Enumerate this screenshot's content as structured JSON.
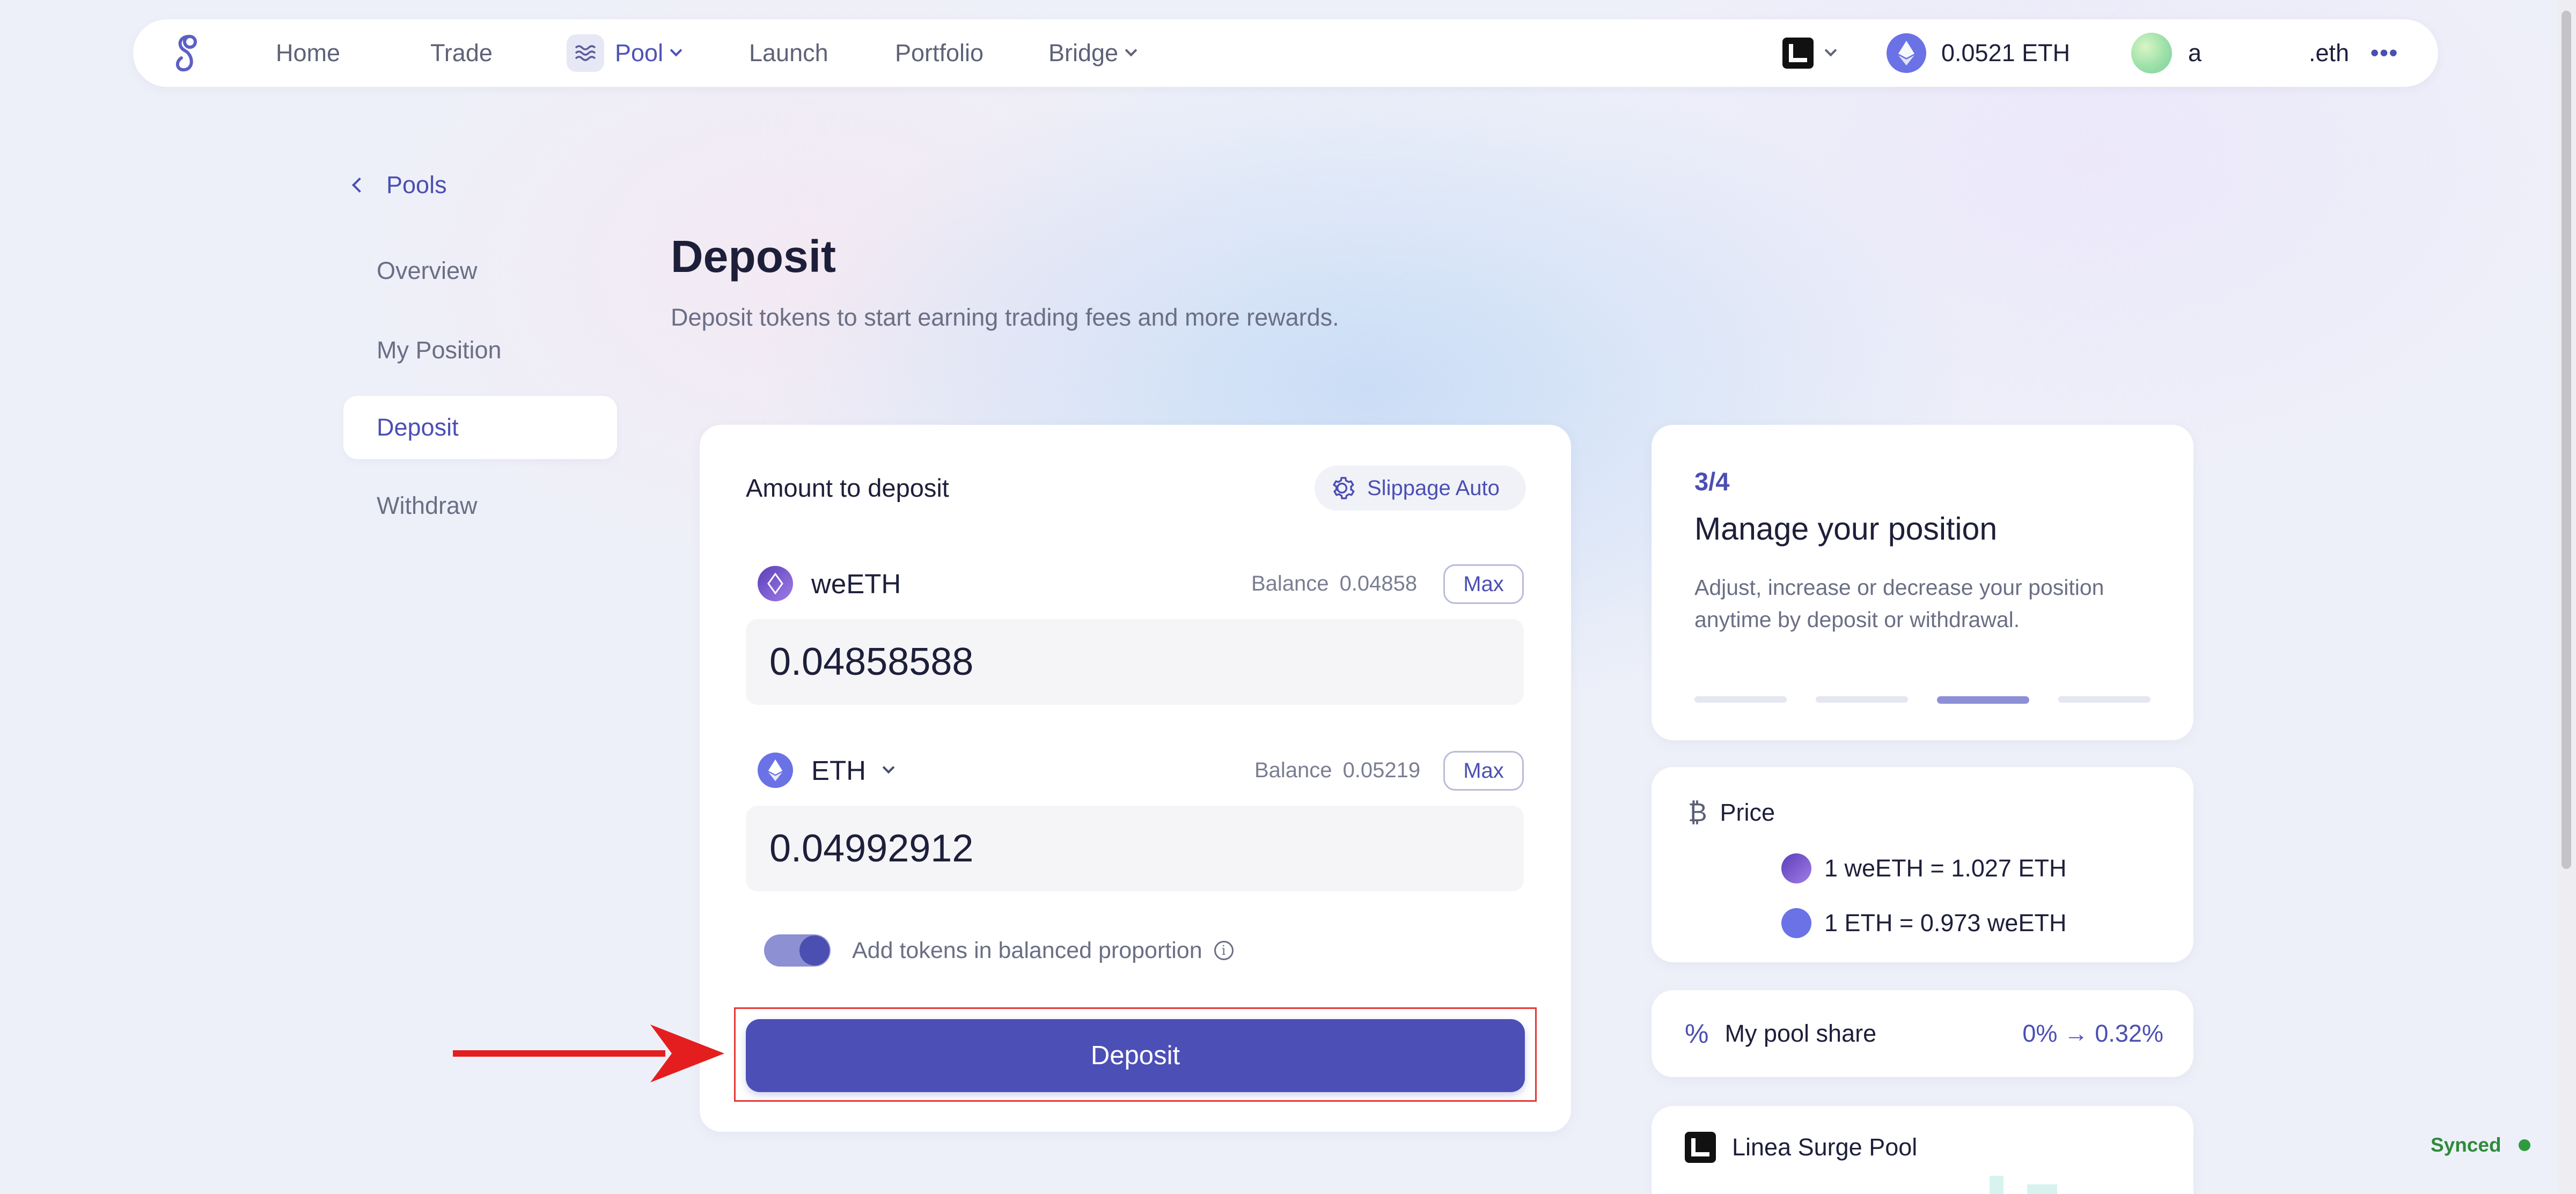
{
  "nav": {
    "home": "Home",
    "trade": "Trade",
    "pool": "Pool",
    "launch": "Launch",
    "portfolio": "Portfolio",
    "bridge": "Bridge",
    "balance": "0.0521 ETH",
    "account_initial": "a",
    "account_suffix": ".eth",
    "more": "•••"
  },
  "breadcrumb": {
    "back_label": "Pools"
  },
  "sidebar": {
    "items": [
      {
        "label": "Overview",
        "active": false
      },
      {
        "label": "My Position",
        "active": false
      },
      {
        "label": "Deposit",
        "active": true
      },
      {
        "label": "Withdraw",
        "active": false
      }
    ]
  },
  "page": {
    "title": "Deposit",
    "subtitle": "Deposit tokens to start earning trading fees and more rewards."
  },
  "deposit_card": {
    "heading": "Amount to deposit",
    "slippage_label": "Slippage Auto",
    "token1": {
      "symbol": "weETH",
      "balance_label": "Balance",
      "balance": "0.04858",
      "max_label": "Max",
      "amount": "0.04858588"
    },
    "token2": {
      "symbol": "ETH",
      "balance_label": "Balance",
      "balance": "0.05219",
      "max_label": "Max",
      "amount": "0.04992912"
    },
    "balanced_label": "Add tokens in balanced proportion",
    "balanced_on": true,
    "submit_label": "Deposit"
  },
  "steps_card": {
    "step": "3/4",
    "title": "Manage your position",
    "description_line1": "Adjust, increase or decrease your position",
    "description_line2": "anytime by deposit or withdrawal.",
    "total_steps": 4,
    "current_step": 3
  },
  "price_card": {
    "label": "Price",
    "rate1": "1 weETH = 1.027 ETH",
    "rate2": "1 ETH = 0.973 weETH"
  },
  "share_card": {
    "label": "My pool share",
    "value": "0% → 0.32%"
  },
  "pool_card": {
    "label": "Linea Surge Pool"
  },
  "status": {
    "label": "Synced"
  },
  "colors": {
    "accent": "#4b4fb2",
    "highlight_box": "#e53935",
    "arrow": "#e41e1e",
    "synced": "#2e8b3a"
  }
}
